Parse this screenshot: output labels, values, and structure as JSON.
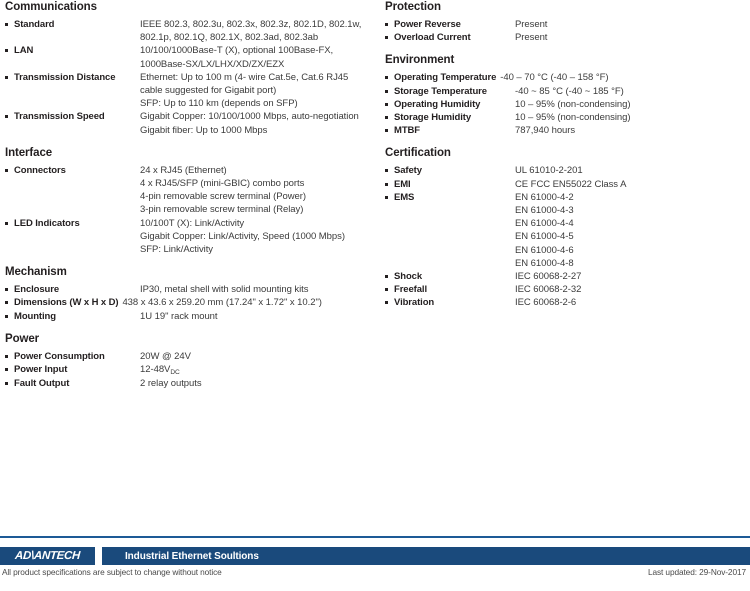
{
  "document": {
    "type": "product-datasheet-specifications"
  },
  "left_column": [
    {
      "title": "Communications",
      "rows": [
        {
          "label": "Standard",
          "value": "IEEE 802.3, 802.3u, 802.3x, 802.3z, 802.1D, 802.1w,\n802.1p, 802.1Q, 802.1X, 802.3ad, 802.3ab"
        },
        {
          "label": "LAN",
          "value": "10/100/1000Base-T (X), optional 100Base-FX,\n1000Base-SX/LX/LHX/XD/ZX/EZX"
        },
        {
          "label": "Transmission Distance",
          "value": "Ethernet: Up to 100 m (4- wire Cat.5e, Cat.6 RJ45\ncable suggested for Gigabit port)\nSFP: Up to 110 km (depends on SFP)"
        },
        {
          "label": "Transmission Speed",
          "value": "Gigabit Copper: 10/100/1000 Mbps, auto-negotiation\nGigabit fiber: Up to 1000 Mbps"
        }
      ]
    },
    {
      "title": "Interface",
      "rows": [
        {
          "label": "Connectors",
          "value": "24 x RJ45 (Ethernet)\n4 x RJ45/SFP (mini-GBIC) combo ports\n4-pin removable screw terminal (Power)\n3-pin removable screw terminal (Relay)"
        },
        {
          "label": "LED Indicators",
          "value": "10/100T (X): Link/Activity\nGigabit Copper: Link/Activity, Speed (1000 Mbps)\nSFP: Link/Activity"
        }
      ]
    },
    {
      "title": "Mechanism",
      "rows": [
        {
          "label": "Enclosure",
          "value": "IP30, metal shell with solid mounting kits"
        },
        {
          "label": "Dimensions (W x H x D)",
          "value": "438 x 43.6 x 259.20 mm (17.24\" x 1.72\" x 10.2\")",
          "wide": true
        },
        {
          "label": "Mounting",
          "value": "1U 19\" rack mount"
        }
      ]
    },
    {
      "title": "Power",
      "rows": [
        {
          "label": "Power Consumption",
          "value": "20W @ 24V"
        },
        {
          "label": "Power Input",
          "value": "12-48V",
          "subscript": "DC"
        },
        {
          "label": "Fault Output",
          "value": "2 relay outputs"
        }
      ]
    }
  ],
  "right_column": [
    {
      "title": "Protection",
      "rows": [
        {
          "label": "Power Reverse",
          "value": "Present"
        },
        {
          "label": "Overload Current",
          "value": "Present"
        }
      ]
    },
    {
      "title": "Environment",
      "rows": [
        {
          "label": "Operating Temperature",
          "value": "-40 – 70 °C (-40 – 158 °F)",
          "wide": true
        },
        {
          "label": "Storage Temperature",
          "value": "-40 ~ 85 °C (-40 ~ 185 °F)"
        },
        {
          "label": "Operating Humidity",
          "value": "10 – 95% (non-condensing)"
        },
        {
          "label": "Storage Humidity",
          "value": "10 – 95% (non-condensing)"
        },
        {
          "label": "MTBF",
          "value": "787,940 hours"
        }
      ]
    },
    {
      "title": "Certification",
      "rows": [
        {
          "label": "Safety",
          "value": "UL 61010-2-201"
        },
        {
          "label": "EMI",
          "value": "CE FCC EN55022 Class A"
        },
        {
          "label": "EMS",
          "value": "EN 61000-4-2\nEN 61000-4-3\nEN 61000-4-4\nEN 61000-4-5\nEN 61000-4-6\nEN 61000-4-8"
        },
        {
          "label": "Shock",
          "value": "IEC 60068-2-27"
        },
        {
          "label": "Freefall",
          "value": "IEC 60068-2-32"
        },
        {
          "label": "Vibration",
          "value": "IEC 60068-2-6"
        }
      ]
    }
  ],
  "footer": {
    "logo": "AD\\ANTECH",
    "tagline": "Industrial Ethernet Soultions",
    "note": "All product specifications are subject to change without notice",
    "last_updated": "Last updated: 29-Nov-2017",
    "brand_color": "#1a4a7c",
    "rule_color": "#1d5a96"
  }
}
